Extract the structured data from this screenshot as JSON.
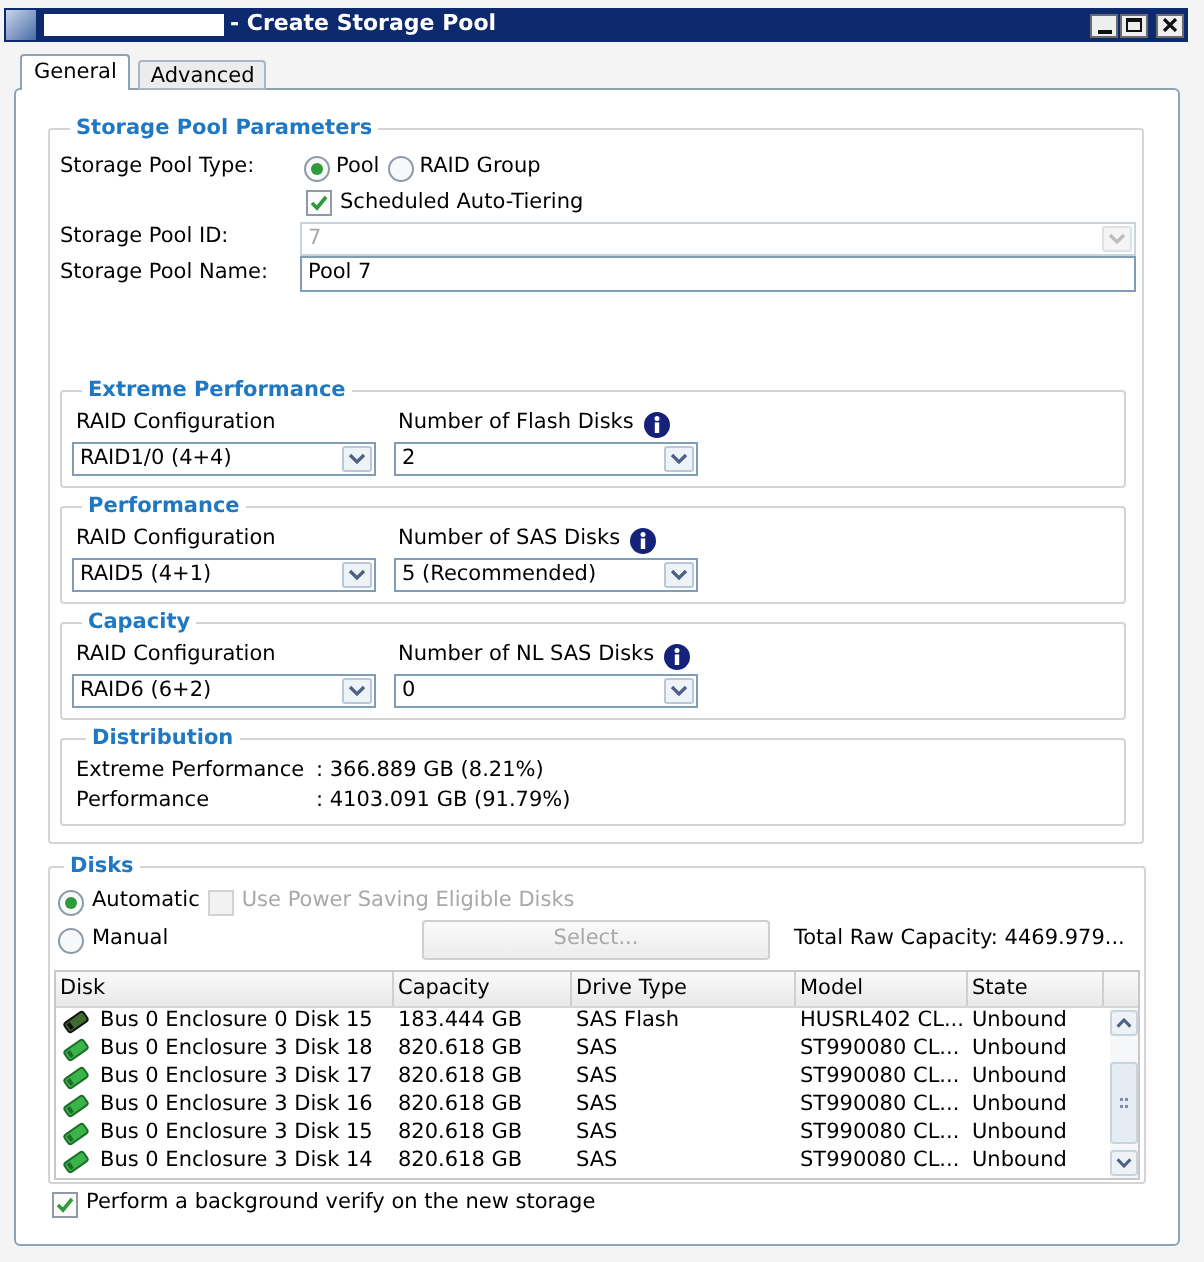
{
  "window": {
    "title": "- Create Storage Pool"
  },
  "tabs": [
    {
      "label": "General",
      "selected": true
    },
    {
      "label": "Advanced",
      "selected": false
    }
  ],
  "pool_parameters": {
    "title": "Storage Pool Parameters",
    "type_label": "Storage Pool Type:",
    "type_options": [
      {
        "label": "Pool",
        "selected": true
      },
      {
        "label": "RAID Group",
        "selected": false
      }
    ],
    "auto_tiering": {
      "label": "Scheduled Auto-Tiering",
      "checked": true
    },
    "pool_id": {
      "label": "Storage Pool ID:",
      "value": "7",
      "disabled": true
    },
    "pool_name": {
      "label": "Storage Pool Name:",
      "value": "Pool 7"
    }
  },
  "tiers": [
    {
      "title": "Extreme Performance",
      "raid_label": "RAID Configuration",
      "raid_value": "RAID1/0 (4+4)",
      "disks_label": "Number of Flash Disks",
      "disks_value": "2"
    },
    {
      "title": "Performance",
      "raid_label": "RAID Configuration",
      "raid_value": "RAID5 (4+1)",
      "disks_label": "Number of SAS Disks",
      "disks_value": "5 (Recommended)"
    },
    {
      "title": "Capacity",
      "raid_label": "RAID Configuration",
      "raid_value": "RAID6 (6+2)",
      "disks_label": "Number of NL SAS Disks",
      "disks_value": "0"
    }
  ],
  "distribution": {
    "title": "Distribution",
    "rows": [
      {
        "name": "Extreme Performance",
        "value": ": 366.889 GB (8.21%)"
      },
      {
        "name": "Performance",
        "value": ": 4103.091 GB (91.79%)"
      }
    ]
  },
  "disks": {
    "title": "Disks",
    "modes": [
      {
        "label": "Automatic",
        "selected": true
      },
      {
        "label": "Manual",
        "selected": false
      }
    ],
    "power_saving": {
      "label": "Use Power Saving Eligible Disks",
      "checked": false,
      "disabled": true
    },
    "select_button": {
      "label": "Select...",
      "disabled": true
    },
    "total_capacity": "Total Raw Capacity: 4469.979...",
    "table": {
      "columns": [
        "Disk",
        "Capacity",
        "Drive Type",
        "Model",
        "State"
      ],
      "rows": [
        {
          "kind": "flash",
          "cells": [
            "Bus 0 Enclosure 0 Disk 15",
            "183.444 GB",
            "SAS Flash",
            "HUSRL402 CL...",
            "Unbound"
          ]
        },
        {
          "kind": "sas",
          "cells": [
            "Bus 0 Enclosure 3 Disk 18",
            "820.618 GB",
            "SAS",
            "ST990080 CL...",
            "Unbound"
          ]
        },
        {
          "kind": "sas",
          "cells": [
            "Bus 0 Enclosure 3 Disk 17",
            "820.618 GB",
            "SAS",
            "ST990080 CL...",
            "Unbound"
          ]
        },
        {
          "kind": "sas",
          "cells": [
            "Bus 0 Enclosure 3 Disk 16",
            "820.618 GB",
            "SAS",
            "ST990080 CL...",
            "Unbound"
          ]
        },
        {
          "kind": "sas",
          "cells": [
            "Bus 0 Enclosure 3 Disk 15",
            "820.618 GB",
            "SAS",
            "ST990080 CL...",
            "Unbound"
          ]
        },
        {
          "kind": "sas",
          "cells": [
            "Bus 0 Enclosure 3 Disk 14",
            "820.618 GB",
            "SAS",
            "ST990080 CL...",
            "Unbound"
          ]
        }
      ]
    }
  },
  "verify": {
    "label": "Perform a background verify on the new storage",
    "checked": true
  }
}
